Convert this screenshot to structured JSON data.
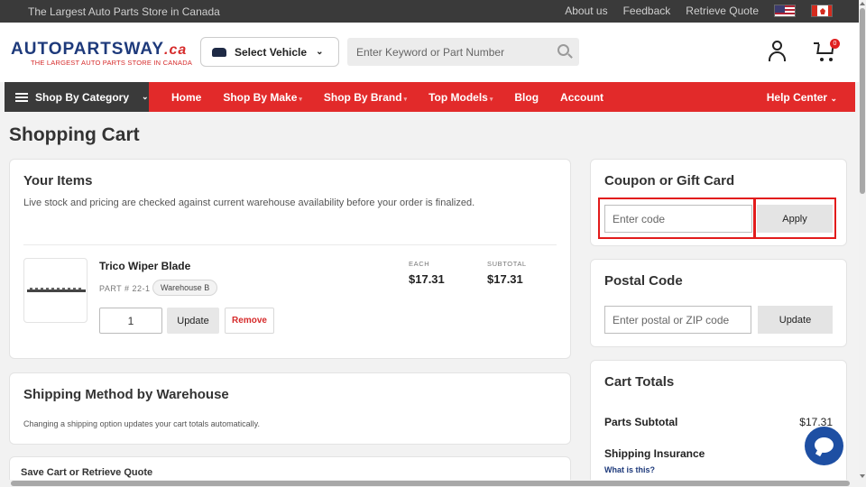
{
  "topbar": {
    "tagline": "The Largest Auto Parts Store in Canada",
    "links": [
      "About us",
      "Feedback",
      "Retrieve Quote"
    ],
    "flags": [
      "us-flag",
      "canada-flag"
    ]
  },
  "header": {
    "logo_main": "AUTOPARTSWAY",
    "logo_suffix": ".ca",
    "logo_sub": "THE LARGEST AUTO PARTS STORE IN CANADA",
    "select_vehicle": "Select Vehicle",
    "search_placeholder": "Enter Keyword or Part Number",
    "cart_count": "0"
  },
  "nav": {
    "category": "Shop By Category",
    "items": [
      "Home",
      "Shop By Make",
      "Shop By Brand",
      "Top Models",
      "Blog",
      "Account"
    ],
    "help": "Help Center",
    "color": "#e22a2a"
  },
  "page_title": "Shopping Cart",
  "items_card": {
    "title": "Your Items",
    "note": "Live stock and pricing are checked against current warehouse availability before your order is finalized.",
    "product": {
      "name": "Trico Wiper Blade",
      "part": "PART # 22-1",
      "warehouse": "Warehouse B",
      "each_label": "EACH",
      "each_value": "$17.31",
      "subtotal_label": "SUBTOTAL",
      "subtotal_value": "$17.31",
      "quantity": "1",
      "update_label": "Update",
      "remove_label": "Remove"
    }
  },
  "shipping_card": {
    "title": "Shipping Method by Warehouse",
    "note": "Changing a shipping option updates your cart totals automatically."
  },
  "save_card": {
    "title": "Save Cart or Retrieve Quote"
  },
  "coupon_card": {
    "title": "Coupon or Gift Card",
    "placeholder": "Enter code",
    "apply_label": "Apply",
    "highlight_color": "#e21b1b"
  },
  "postal_card": {
    "title": "Postal Code",
    "placeholder": "Enter postal or ZIP code",
    "update_label": "Update"
  },
  "totals_card": {
    "title": "Cart Totals",
    "parts_subtotal_label": "Parts Subtotal",
    "parts_subtotal_value": "$17.31",
    "shipping_insurance_label": "Shipping Insurance",
    "what_is_this": "What is this?"
  }
}
